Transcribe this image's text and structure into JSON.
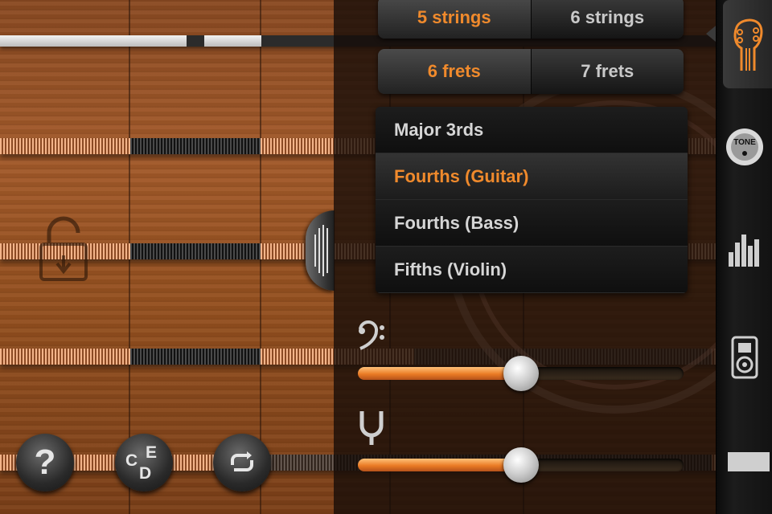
{
  "strings_control": {
    "options": [
      "5 strings",
      "6 strings"
    ],
    "selected": "5 strings"
  },
  "frets_control": {
    "options": [
      "6 frets",
      "7 frets"
    ],
    "selected": "6 frets"
  },
  "tunings": {
    "items": [
      "Major 3rds",
      "Fourths (Guitar)",
      "Fourths (Bass)",
      "Fifths (Violin)"
    ],
    "selected": "Fourths (Guitar)"
  },
  "sliders": {
    "bass_level": 0.5,
    "tuning_level": 0.5
  },
  "buttons": {
    "help_label": "?",
    "notes_labels": [
      "C",
      "E",
      "D"
    ]
  },
  "sidebar": {
    "tone_label": "TONE"
  },
  "colors": {
    "accent": "#f08a2c",
    "selected_text": "#f08a2c",
    "text": "#d6d6d6"
  },
  "icons": [
    "guitar-headstock-icon",
    "tone-knob-icon",
    "level-meter-icon",
    "speaker-icon",
    "bass-clef-icon",
    "tuning-fork-icon",
    "lock-icon",
    "loop-icon"
  ]
}
